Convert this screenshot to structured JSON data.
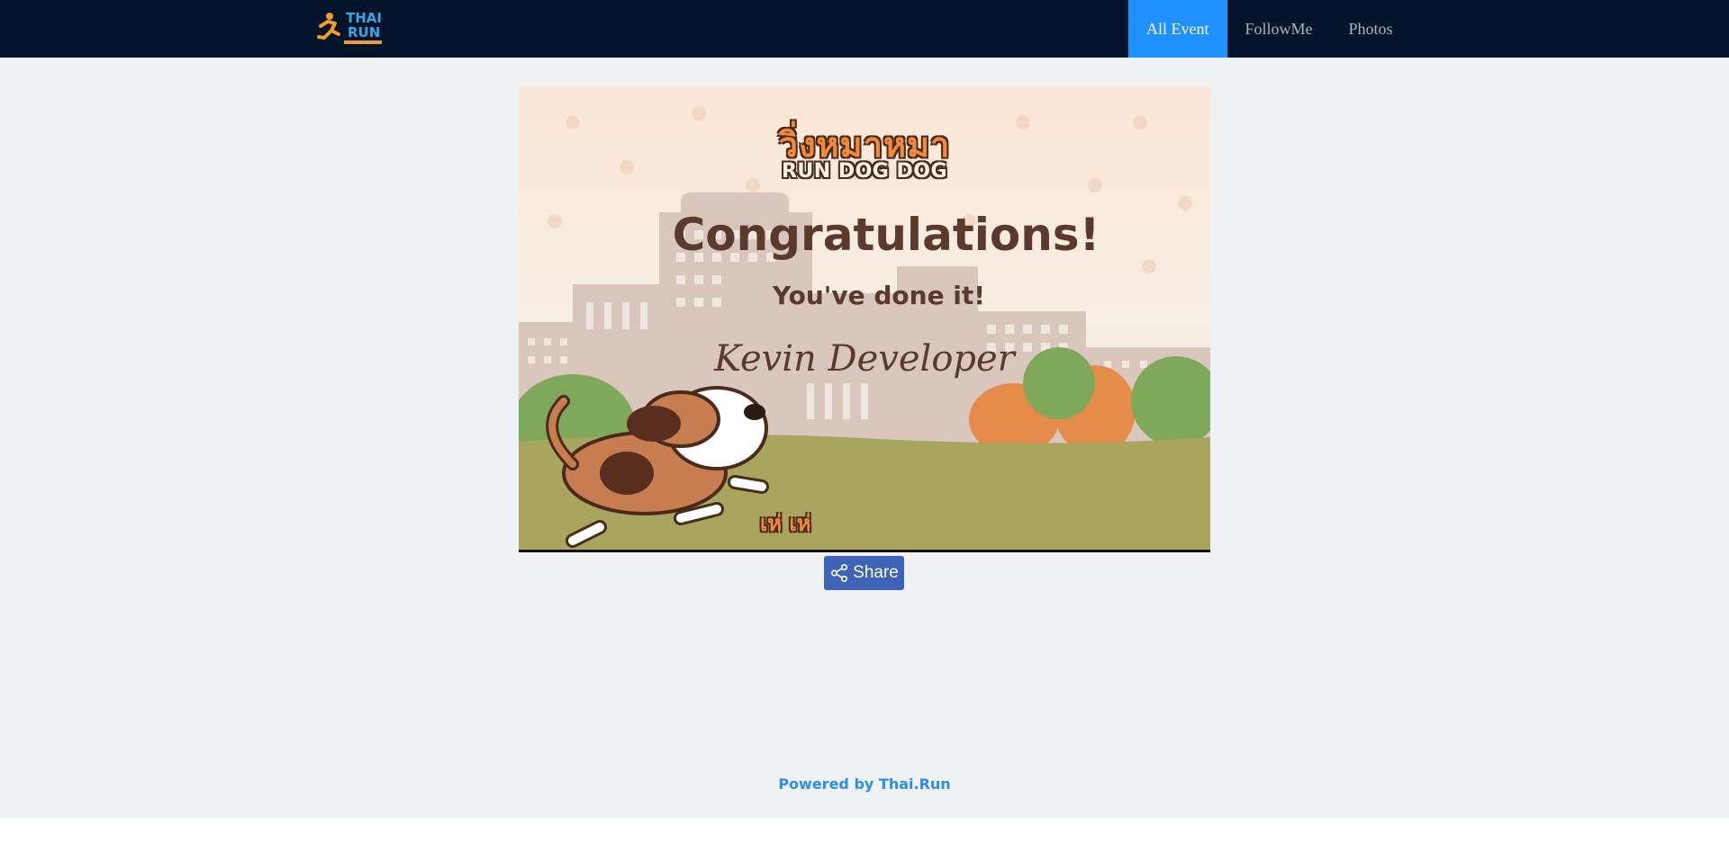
{
  "nav": {
    "logo_line1": "THAI",
    "logo_line2": "RUN",
    "links": [
      {
        "label": "All Event",
        "active": true
      },
      {
        "label": "FollowMe",
        "active": false
      },
      {
        "label": "Photos",
        "active": false
      }
    ]
  },
  "certificate": {
    "brand_thai": "วิ่งหมาหมา",
    "brand_en": "RUN DOG DOG",
    "headline": "Congratulations!",
    "subline": "You've done it!",
    "runner_name": "Kevin Developer",
    "bark_text": "เห่ เห่"
  },
  "share": {
    "label": "Share",
    "icon": "share-icon"
  },
  "footer": {
    "prefix": "Powered by",
    "link_text": "Thai.Run"
  },
  "colors": {
    "navbar_bg": "#02142a",
    "nav_active_bg": "#1e90ff",
    "page_bg": "#f0f1f3",
    "share_button_bg": "#3f63b8",
    "footer_link": "#2a8df0"
  }
}
